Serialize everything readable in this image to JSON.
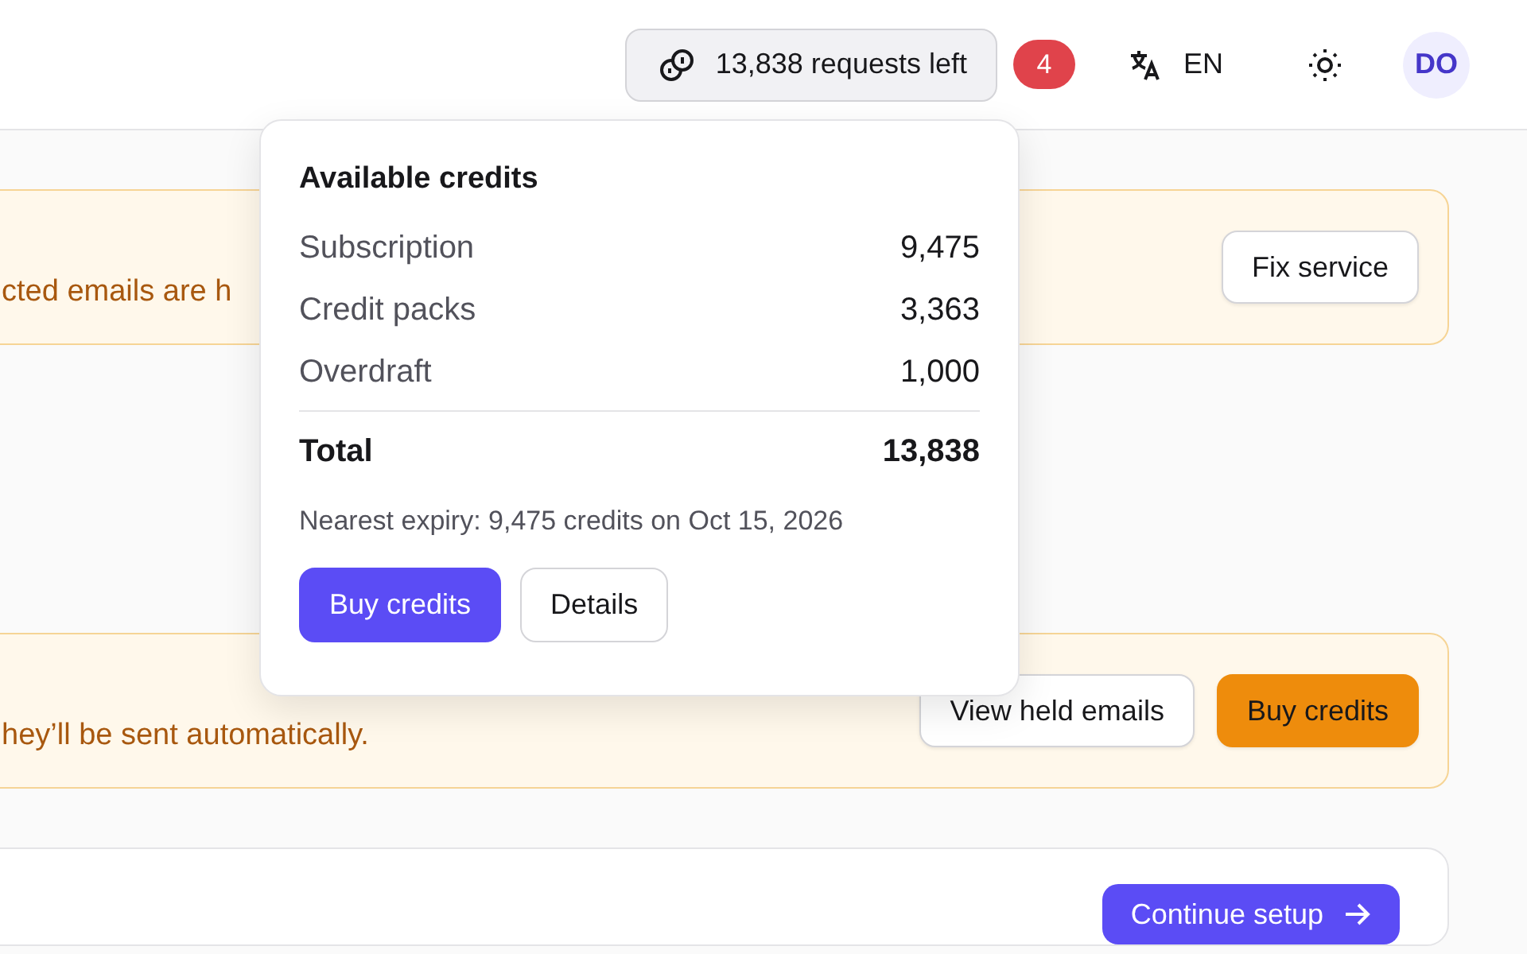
{
  "header": {
    "requests": "13,838 requests left",
    "notifications": "4",
    "language": "EN",
    "avatar": "DO"
  },
  "alerts": [
    {
      "text": "cted emails are h",
      "buttons": [
        {
          "label": "Fix service",
          "kind": "secondary"
        }
      ]
    },
    {
      "text": "hey’ll be sent automatically.",
      "buttons": [
        {
          "label": "View held emails",
          "kind": "secondary"
        },
        {
          "label": "Buy credits",
          "kind": "warning"
        }
      ]
    }
  ],
  "setup_card": {
    "button": "Continue setup"
  },
  "credits_popover": {
    "title": "Available credits",
    "rows": [
      {
        "label": "Subscription",
        "value": "9,475"
      },
      {
        "label": "Credit packs",
        "value": "3,363"
      },
      {
        "label": "Overdraft",
        "value": "1,000"
      }
    ],
    "total": {
      "label": "Total",
      "value": "13,838"
    },
    "expiry": "Nearest expiry: 9,475 credits on Oct 15, 2026",
    "buttons": [
      {
        "label": "Buy credits",
        "kind": "primary"
      },
      {
        "label": "Details",
        "kind": "secondary"
      }
    ]
  }
}
